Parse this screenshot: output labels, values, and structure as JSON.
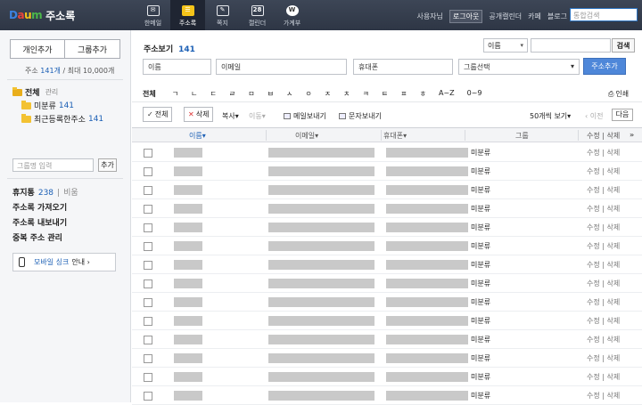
{
  "header": {
    "logo_text": "Daum",
    "app_title": "주소록",
    "nav": [
      {
        "label": "한메일",
        "icon": "mail-icon",
        "glyph": "✉"
      },
      {
        "label": "주소록",
        "icon": "address-book-icon",
        "glyph": "☰"
      },
      {
        "label": "쪽지",
        "icon": "memo-icon",
        "glyph": "✎"
      },
      {
        "label": "캘린더",
        "icon": "calendar-icon",
        "glyph": "28"
      },
      {
        "label": "가계부",
        "icon": "ledger-icon",
        "glyph": "W"
      }
    ],
    "user_text": "사용자님",
    "logout": "로그아웃",
    "links": [
      "공개캘린더",
      "카페",
      "블로그"
    ],
    "search_placeholder": "통합검색"
  },
  "sidebar": {
    "add_person": "개인추가",
    "add_group": "그룹추가",
    "count_label": "주소",
    "count_value": "141개",
    "count_max": "/ 최대 10,000개",
    "tree": {
      "root_label": "전체",
      "manage": "관리",
      "items": [
        {
          "label": "미분류",
          "count": "141"
        },
        {
          "label": "최근등록한주소",
          "count": "141"
        }
      ]
    },
    "group_input_placeholder": "그룹명 입력",
    "group_add": "추가",
    "trash_label": "휴지통",
    "trash_count": "238",
    "trash_empty": "비움",
    "import": "주소록 가져오기",
    "export": "주소록 내보내기",
    "dedupe": "중복 주소 관리",
    "mobile_sync_prefix": "모바일 싱크",
    "mobile_sync_suffix": "안내 ›"
  },
  "main": {
    "title": "주소보기",
    "title_count": "141",
    "search_select": "이름",
    "search_button": "검색",
    "form": {
      "name": "이름",
      "email": "이메일",
      "phone": "휴대폰",
      "group_select": "그룹선택",
      "add_button": "주소추가"
    },
    "index_all": "전체",
    "index": [
      "ㄱ",
      "ㄴ",
      "ㄷ",
      "ㄹ",
      "ㅁ",
      "ㅂ",
      "ㅅ",
      "ㅇ",
      "ㅈ",
      "ㅊ",
      "ㅋ",
      "ㅌ",
      "ㅍ",
      "ㅎ",
      "A~Z",
      "0~9"
    ],
    "print": "인쇄",
    "toolbar": {
      "select_all": "전체",
      "delete": "삭제",
      "copy": "복사",
      "move": "이동",
      "send_mail": "메일보내기",
      "send_sms": "문자보내기",
      "per_page": "50개씩 보기",
      "prev": "‹ 이전",
      "next": "다음"
    },
    "columns": {
      "name": "이름",
      "email": "이메일",
      "phone": "휴대폰",
      "group": "그룹",
      "edit_delete": "수정 | 삭제"
    },
    "rows": [
      {
        "group": "미분류",
        "actions": "수정 | 삭제"
      },
      {
        "group": "미분류",
        "actions": "수정 | 삭제"
      },
      {
        "group": "미분류",
        "actions": "수정 | 삭제"
      },
      {
        "group": "미분류",
        "actions": "수정 | 삭제"
      },
      {
        "group": "미분류",
        "actions": "수정 | 삭제"
      },
      {
        "group": "미분류",
        "actions": "수정 | 삭제"
      },
      {
        "group": "미분류",
        "actions": "수정 | 삭제"
      },
      {
        "group": "미분류",
        "actions": "수정 | 삭제"
      },
      {
        "group": "미분류",
        "actions": "수정 | 삭제"
      },
      {
        "group": "미분류",
        "actions": "수정 | 삭제"
      },
      {
        "group": "미분류",
        "actions": "수정 | 삭제"
      },
      {
        "group": "미분류",
        "actions": "수정 | 삭제"
      },
      {
        "group": "미분류",
        "actions": "수정 | 삭제"
      },
      {
        "group": "미분류",
        "actions": "수정 | 삭제"
      },
      {
        "group": "미분류",
        "actions": "수정 | 삭제"
      }
    ]
  }
}
